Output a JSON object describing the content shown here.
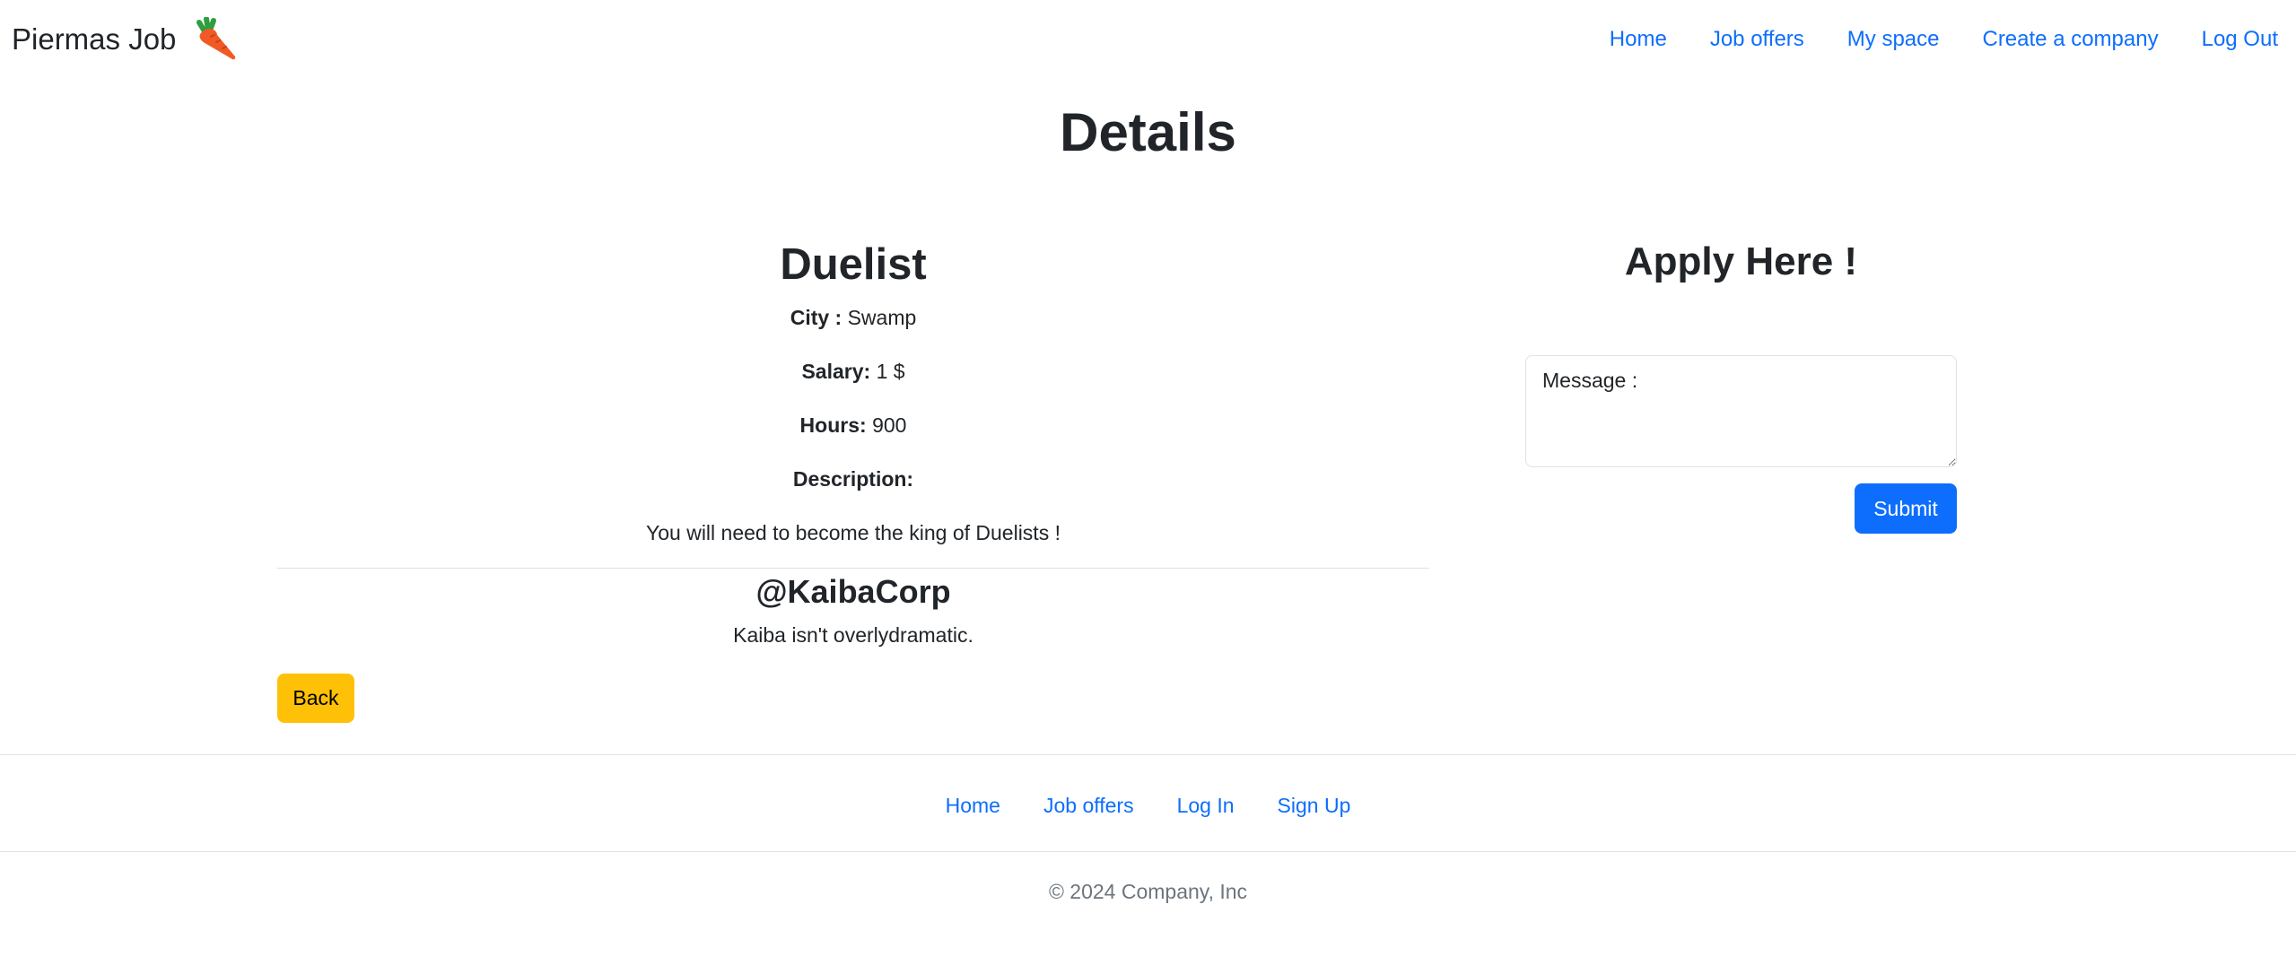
{
  "navbar": {
    "brand": "Piermas Job",
    "brand_icon": "carrot-icon",
    "links": [
      "Home",
      "Job offers",
      "My space",
      "Create a company",
      "Log Out"
    ]
  },
  "page": {
    "title": "Details"
  },
  "job": {
    "title": "Duelist",
    "city_label": "City :",
    "city": "Swamp",
    "salary_label": "Salary:",
    "salary": "1 $",
    "hours_label": "Hours:",
    "hours": "900",
    "description_label": "Description:",
    "description": "You will need to become the king of Duelists !"
  },
  "company": {
    "name": "@KaibaCorp",
    "description": "Kaiba isn't overlydramatic."
  },
  "actions": {
    "back_label": "Back"
  },
  "apply": {
    "title": "Apply Here !",
    "message_placeholder": "Message :",
    "submit_label": "Submit"
  },
  "footer": {
    "links": [
      "Home",
      "Job offers",
      "Log In",
      "Sign Up"
    ],
    "copyright": "© 2024 Company, Inc"
  },
  "colors": {
    "link": "#0d6efd",
    "back_button": "#ffc107",
    "submit_button": "#0d6efd",
    "muted_text": "#6c757d"
  }
}
